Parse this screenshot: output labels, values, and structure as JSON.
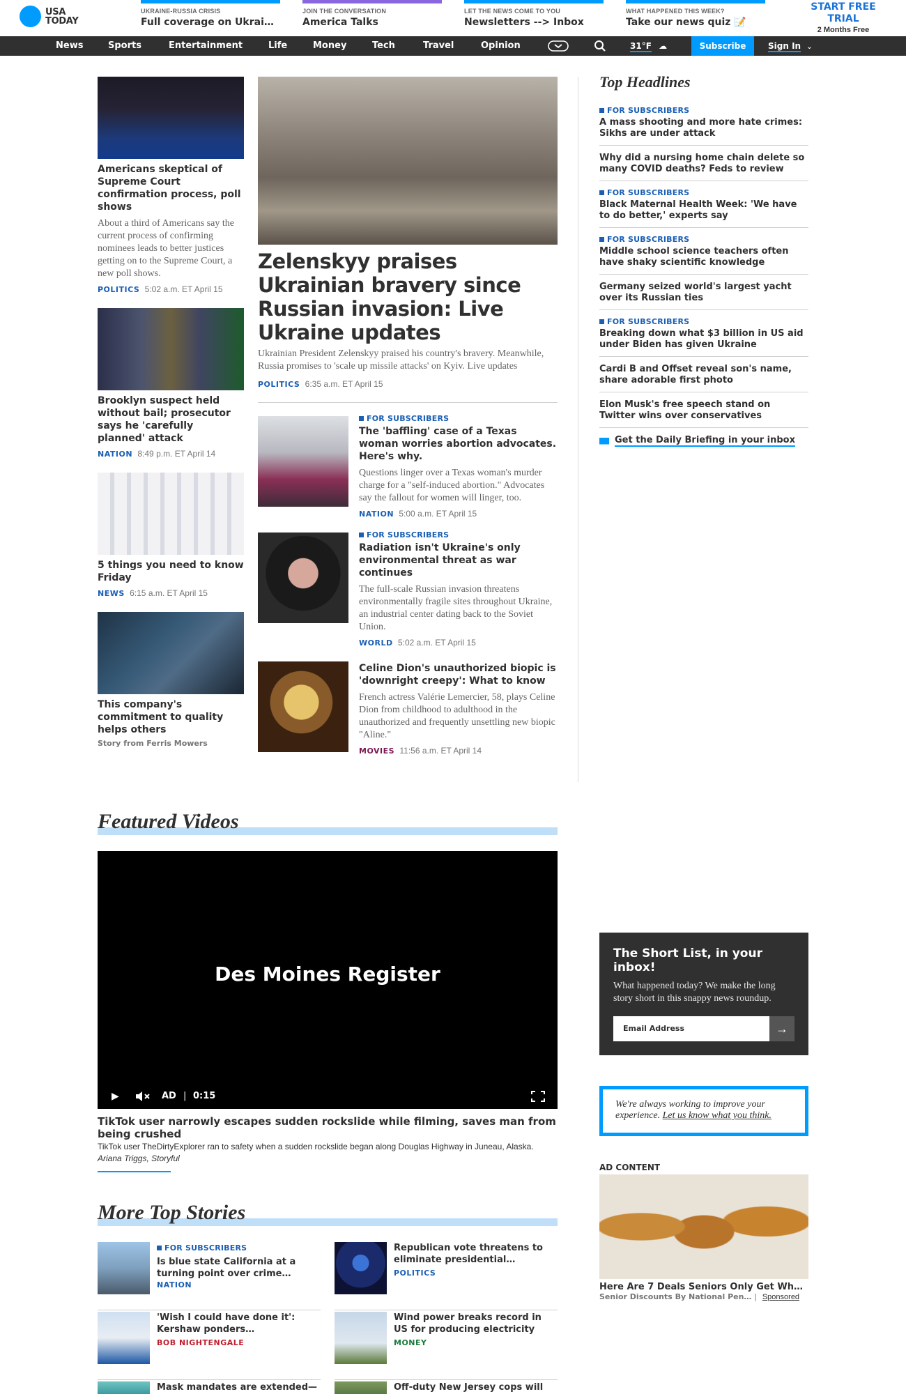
{
  "header": {
    "logo_line1": "USA",
    "logo_line2": "TODAY",
    "promos": [
      {
        "kicker": "UKRAINE-RUSSIA CRISIS",
        "title": "Full coverage on Ukrai…",
        "color": "#009bff"
      },
      {
        "kicker": "JOIN THE CONVERSATION",
        "title": "America Talks",
        "color": "#8a67e0"
      },
      {
        "kicker": "LET THE NEWS COME TO YOU",
        "title": "Newsletters --> Inbox",
        "color": "#009bff"
      },
      {
        "kicker": "WHAT HAPPENED THIS WEEK?",
        "title": "Take our news quiz 📝",
        "color": "#009bff"
      }
    ],
    "trial_line1": "START FREE",
    "trial_line2": "TRIAL",
    "trial_sub": "2 Months Free"
  },
  "nav": {
    "items": [
      "News",
      "Sports",
      "Entertainment",
      "Life",
      "Money",
      "Tech",
      "Travel",
      "Opinion"
    ],
    "weather": "31°F",
    "subscribe": "Subscribe",
    "signin": "Sign In"
  },
  "left_stories": [
    {
      "headline": "Americans skeptical of Supreme Court confirmation process, poll shows",
      "summary": "About a third of Americans say the current process of confirming nominees leads to better justices getting on to the Supreme Court, a new poll shows.",
      "section": "POLITICS",
      "time": "5:02 a.m. ET April 15"
    },
    {
      "headline": "Brooklyn suspect held without bail; prosecutor says he 'carefully planned' attack",
      "section": "NATION",
      "time": "8:49 p.m. ET April 14"
    },
    {
      "headline": "5 things you need to know Friday",
      "section": "NEWS",
      "time": "6:15 a.m. ET April 15"
    },
    {
      "headline": "This company's commitment to quality helps others",
      "sponsor": "Story from Ferris Mowers"
    }
  ],
  "lead": {
    "headline": "Zelenskyy praises Ukrainian bravery since Russian invasion: Live Ukraine updates",
    "summary": "Ukrainian President Zelenskyy praised his country's bravery. Meanwhile, Russia promises to 'scale up missile attacks' on Kyiv. Live updates",
    "section": "POLITICS",
    "time": "6:35 a.m. ET April 15"
  },
  "center_stories": [
    {
      "badge": "FOR SUBSCRIBERS",
      "headline": "The 'baffling' case of a Texas woman worries abortion advocates. Here's why.",
      "summary": "Questions linger over a Texas woman's murder charge for a \"self-induced abortion.\" Advocates say the fallout for women will linger, too.",
      "section": "NATION",
      "time": "5:00 a.m. ET April 15"
    },
    {
      "badge": "FOR SUBSCRIBERS",
      "headline": "Radiation isn't Ukraine's only environmental threat as war continues",
      "summary": "The full-scale Russian invasion threatens environmentally fragile sites throughout Ukraine, an industrial center dating back to the Soviet Union.",
      "section": "WORLD",
      "time": "5:02 a.m. ET April 15"
    },
    {
      "headline": "Celine Dion's unauthorized biopic is 'downright creepy': What to know",
      "summary": "French actress Valérie Lemercier, 58, plays Celine Dion from childhood to adulthood in the unauthorized and frequently unsettling new biopic \"Aline.\"",
      "section": "MOVIES",
      "time": "11:56 a.m. ET April 14"
    }
  ],
  "top_headlines": {
    "title": "Top Headlines",
    "items": [
      {
        "badge": "FOR SUBSCRIBERS",
        "headline": "A mass shooting and more hate crimes: Sikhs are under attack"
      },
      {
        "headline": "Why did a nursing home chain delete so many COVID deaths? Feds to review"
      },
      {
        "badge": "FOR SUBSCRIBERS",
        "headline": "Black Maternal Health Week: 'We have to do better,' experts say"
      },
      {
        "badge": "FOR SUBSCRIBERS",
        "headline": "Middle school science teachers often have shaky scientific knowledge"
      },
      {
        "headline": "Germany seized world's largest yacht over its Russian ties"
      },
      {
        "badge": "FOR SUBSCRIBERS",
        "headline": "Breaking down what $3 billion in US aid under Biden has given Ukraine"
      },
      {
        "headline": "Cardi B and Offset reveal son's name, share adorable first photo"
      },
      {
        "headline": "Elon Musk's free speech stand on Twitter wins over conservatives"
      }
    ],
    "briefing": "Get the Daily Briefing in your inbox"
  },
  "featured_videos": {
    "title": "Featured Videos",
    "brand": "Des Moines Register",
    "ad_label": "AD",
    "ad_time": "0:15",
    "headline": "TikTok user narrowly escapes sudden rockslide while filming, saves man from being crushed",
    "description": "TikTok user TheDirtyExplorer ran to safety when a sudden rockslide began along Douglas Highway in Juneau, Alaska.",
    "credit": "Ariana Triggs, Storyful"
  },
  "short_list": {
    "title": "The Short List, in your inbox!",
    "description": "What happened today? We make the long story short in this snappy news roundup.",
    "placeholder": "Email Address"
  },
  "feedback": {
    "text": "We're always working to improve your experience.",
    "link": "Let us know what you think."
  },
  "ad": {
    "label": "AD CONTENT",
    "headline": "Here Are 7 Deals Seniors Only Get Whe…",
    "source": "Senior Discounts By National Pen…",
    "sponsored": "Sponsored"
  },
  "more_top_stories": {
    "title": "More Top Stories",
    "items": [
      {
        "badge": "FOR SUBSCRIBERS",
        "headline": "Is blue state California at a turning point over crime…",
        "section": "NATION",
        "section_color": "#1a5fb4"
      },
      {
        "headline": "Republican vote threatens to eliminate presidential…",
        "section": "POLITICS",
        "section_color": "#1a5fb4"
      },
      {
        "headline": "'Wish I could have done it': Kershaw ponders…",
        "section": "BOB NIGHTENGALE",
        "section_color": "#c01f2e"
      },
      {
        "headline": "Wind power breaks record in US for producing electricity",
        "section": "MONEY",
        "section_color": "#1a7a3a"
      },
      {
        "headline": "Mask mandates are extended—"
      },
      {
        "headline": "Off-duty New Jersey cops will be"
      }
    ]
  }
}
